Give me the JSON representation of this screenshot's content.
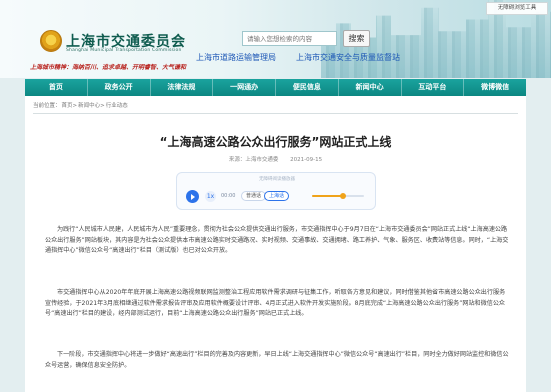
{
  "header": {
    "logo_title": "上海市交通委员会",
    "logo_subtitle": "Shanghai Municipal Transportation Commission",
    "slogan": "上海城市精神：海纳百川、追求卓越、开明睿智、大气谦和",
    "search_placeholder": "请输入您想检索的内容",
    "search_button": "搜索",
    "links": [
      "上海市道路运输管理局",
      "上海市交通安全与质量监督站"
    ],
    "accessibility_label": "无障碍浏览工具"
  },
  "nav": {
    "items": [
      "首页",
      "政务公开",
      "法律法规",
      "一网通办",
      "便民信息",
      "新闻中心",
      "互动平台",
      "微博微信"
    ]
  },
  "breadcrumb": {
    "prefix": "当前位置：",
    "items": [
      "首页",
      "新闻中心",
      "行业动态"
    ],
    "separator": ">"
  },
  "article": {
    "title": "“上海高速公路公众出行服务”网站正式上线",
    "source": "来源：上海市交通委",
    "date": "2021-09-15",
    "paragraphs": [
      "为践行“人民城市人民建，人民城市为人民”重要理念，贯彻为社会公众提供交通出行服务，市交通指挥中心于9月7日在“上海市交通委员会”网站正式上线“上海高速公路公众出行服务”网站板块，其内容是为社会公众提供本市高速公路实时交通路况、实时视频、交通事故、交通拥堵、路工养护、气象、服务区、收费站等信息。同时，“上海交通指挥中心”微信公众号“高速出行”栏目（测试版）也已对公众开放。",
      "市交通指挥中心从2020年年底开展上海高速公路视频联网监测整治工程应用软件需求调研与征集工作，听取各方意见和建议，同时借鉴其他省市高速公路公众出行服务宣传经验，于2021年3月底相继通过软件需求报告评审及应用软件概要设计评审、4月正式进入软件开发实施阶段。8月底完成“上海高速公路公众出行服务”网站和微信公众号“高速出行”栏目的建设，经内部测试运行，目前“上海高速公路公众出行服务”网站已正式上线。",
      "下一阶段，市交通指挥中心将进一步做好“高速出行”栏目的完善及内容更新，早日上线“上海交通指挥中心”微信公众号“高速出行”栏目，同时全力做好网站监控和微信公众号运营，确保信息安全防护。"
    ]
  },
  "audio_player": {
    "header": "无障碍阅读播放器",
    "rate_label": "1x",
    "time": "00:00",
    "voice_tabs": [
      "普通话",
      "上海话"
    ],
    "progress": 0.6,
    "accent_color": "#f0a31a",
    "play_icon": "play-icon"
  },
  "colors": {
    "nav_bg": "#0c8782",
    "page_bg": "#e3eef0",
    "logo_green": "#0f5c4f",
    "link_blue": "#1d57b6",
    "slogan_red": "#b8231e"
  }
}
